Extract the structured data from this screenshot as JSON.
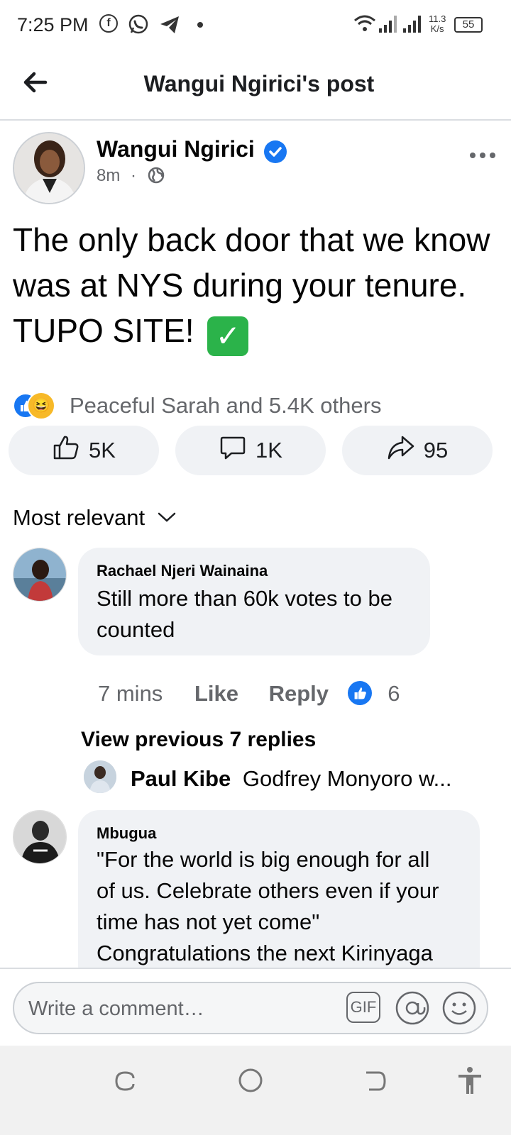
{
  "status_bar": {
    "time": "7:25 PM",
    "net_speed_value": "11.3",
    "net_speed_unit": "K/s",
    "battery": "55",
    "icons": [
      "facebook-icon",
      "whatsapp-icon",
      "telegram-icon",
      "dot-icon",
      "wifi-icon",
      "signal-icon",
      "signal-icon",
      "battery-icon"
    ]
  },
  "header": {
    "title": "Wangui Ngirici's post"
  },
  "post": {
    "author": "Wangui Ngirici",
    "time": "8m",
    "separator": "·",
    "text": "The only back door that we know was at NYS during your tenure. TUPO SITE!",
    "emoji_icon": "check-mark-button-icon",
    "reactions_summary": "Peaceful Sarah and 5.4K others",
    "likes": "5K",
    "comments": "1K",
    "shares": "95"
  },
  "sort": {
    "label": "Most relevant"
  },
  "comments": [
    {
      "name": "Rachael Njeri Wainaina",
      "text": "Still more than 60k votes to be counted",
      "time": "7 mins",
      "like_label": "Like",
      "reply_label": "Reply",
      "reaction_count": "6",
      "view_previous": "View previous 7 replies",
      "reply": {
        "name": "Paul Kibe",
        "text": "Godfrey Monyoro w..."
      }
    },
    {
      "name": "Mbugua",
      "text_lines": [
        "\"For the world is big enough for all",
        "of us. Celebrate others even if your",
        "time has not yet come\"",
        "Congratulations the next Kirinyaga"
      ]
    }
  ],
  "comment_bar": {
    "placeholder": "Write a comment…",
    "gif_label": "GIF"
  },
  "colors": {
    "accent": "#1877f2",
    "bubble": "#f0f2f5",
    "muted_text": "#65676b"
  }
}
